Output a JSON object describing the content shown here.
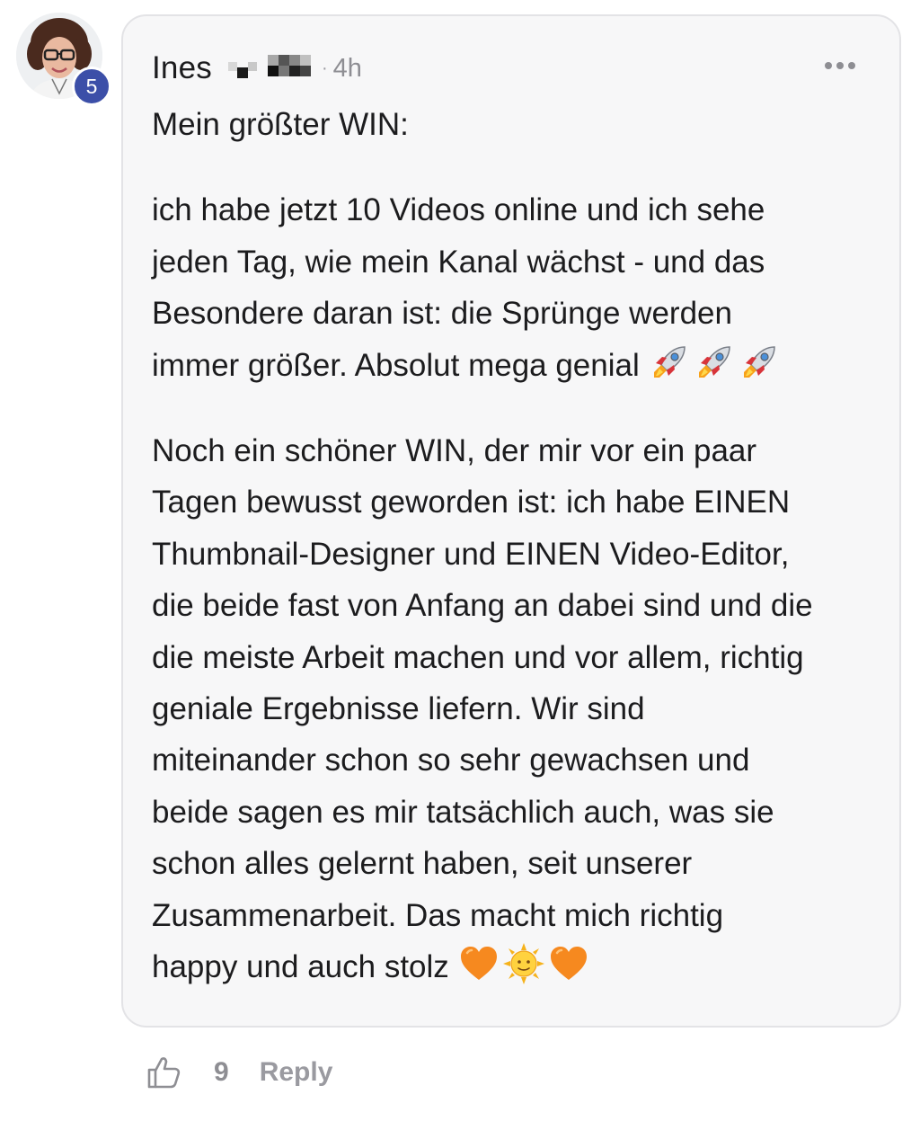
{
  "comment": {
    "author": "Ines",
    "timestamp": "4h",
    "level": "5",
    "paragraphs": [
      {
        "lines": [
          "Mein größter WIN:"
        ],
        "trailing_emojis": []
      },
      {
        "lines": [
          "ich habe jetzt 10 Videos online und ich sehe",
          "jeden Tag, wie mein Kanal wächst - und das",
          "Besondere daran ist: die Sprünge werden",
          "immer größer. Absolut mega genial"
        ],
        "trailing_emojis": [
          "rocket-icon",
          "rocket-icon",
          "rocket-icon"
        ]
      },
      {
        "lines": [
          "Noch ein schöner WIN, der mir vor ein paar",
          "Tagen bewusst geworden ist: ich habe EINEN",
          "Thumbnail-Designer und EINEN Video-Editor,",
          "die beide fast von Anfang an dabei sind und die",
          "die meiste Arbeit machen und vor allem, richtig",
          "geniale Ergebnisse liefern. Wir sind",
          "miteinander schon so sehr gewachsen und",
          "beide sagen es mir tatsächlich auch, was sie",
          "schon alles gelernt haben, seit unserer",
          "Zusammenarbeit. Das macht mich richtig",
          "happy und auch stolz"
        ],
        "trailing_emojis": [
          "orange-heart-icon",
          "sun-with-face-icon",
          "orange-heart-icon"
        ]
      }
    ]
  },
  "footer": {
    "like_count": "9",
    "reply_label": "Reply"
  },
  "colors": {
    "card_background": "#f7f7f8",
    "card_border": "#e3e3e6",
    "badge": "#3c4fa8",
    "muted_text": "#8e8e93"
  }
}
